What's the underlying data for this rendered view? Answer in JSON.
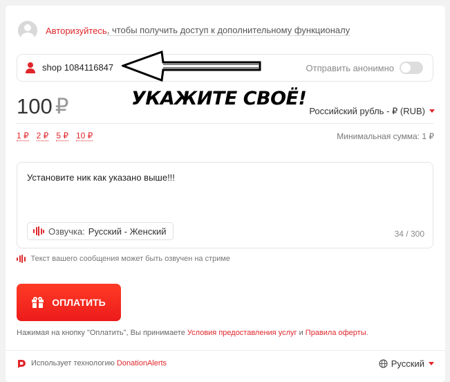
{
  "auth": {
    "link_text": "Авторизуйтесь",
    "rest_text": ", чтобы получить доступ к дополнительному функционалу"
  },
  "name_field": {
    "value": "shop 1084116847",
    "anon_label": "Отправить анонимно",
    "anon_enabled": false
  },
  "annotation": {
    "text": "УКАЖИТЕ СВОЁ!"
  },
  "amount": {
    "value": "100",
    "currency_symbol": "₽",
    "currency_select": "Российский рубль - ₽ (RUB)"
  },
  "presets": [
    "1 ₽",
    "2 ₽",
    "5 ₽",
    "10 ₽"
  ],
  "min_sum": "Минимальная сумма: 1 ₽",
  "message": {
    "text": "Установите ник как указано выше!!!",
    "voice_label": "Озвучка:",
    "voice_value": "Русский - Женский",
    "counter": "34 / 300"
  },
  "hint": "Текст вашего сообщения может быть озвучен на стриме",
  "pay_button": "ОПЛАТИТЬ",
  "terms": {
    "prefix": "Нажимая на кнопку \"Оплатить\", Вы принимаете ",
    "link1": "Условия предоставления услуг",
    "and": " и ",
    "link2": "Правила оферты",
    "suffix": "."
  },
  "footer": {
    "powered_text": "Использует технологию ",
    "powered_link": "DonationAlerts",
    "language": "Русский"
  },
  "colors": {
    "accent": "#e0262b",
    "background": "#f2f2f2"
  }
}
